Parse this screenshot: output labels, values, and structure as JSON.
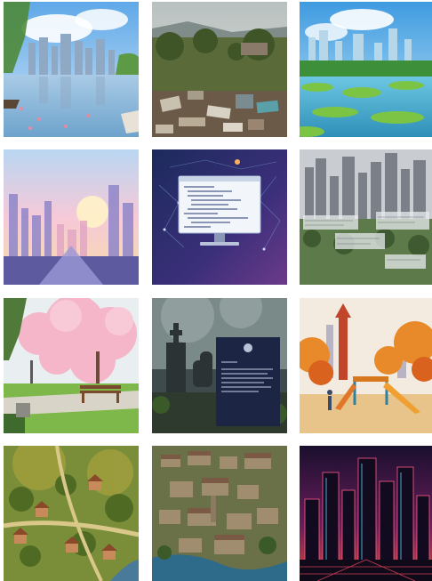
{
  "gallery": {
    "tiles": [
      {
        "icon": "city-lake-reflection-image"
      },
      {
        "icon": "garbage-dump-landscape-image"
      },
      {
        "icon": "city-wetland-park-image"
      },
      {
        "icon": "pastel-city-sunset-image"
      },
      {
        "icon": "code-monitor-illustration"
      },
      {
        "icon": "city-skyline-data-overlay-image"
      },
      {
        "icon": "cherry-blossom-park-bench-image"
      },
      {
        "icon": "cemetery-document-image"
      },
      {
        "icon": "autumn-playground-image"
      },
      {
        "icon": "village-aerial-image"
      },
      {
        "icon": "old-town-aerial-image"
      },
      {
        "icon": "neon-city-skyline-image"
      }
    ]
  }
}
